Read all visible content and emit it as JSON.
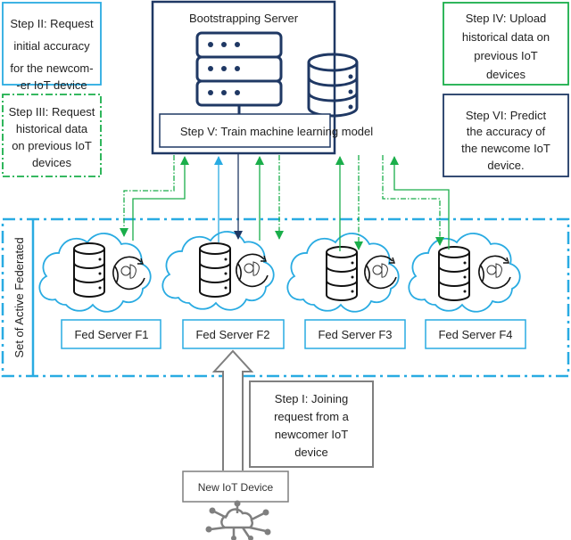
{
  "colors": {
    "blue": "#29abe2",
    "green": "#1aae4a",
    "navy": "#1f3864",
    "gray": "#7f7f7f"
  },
  "bootstrap": {
    "title": "Bootstrapping Server",
    "step5": "Step V: Train machine learning model"
  },
  "steps": {
    "step1": [
      "Step I: Joining",
      "request from a",
      "newcomer IoT",
      "device"
    ],
    "step2": [
      "Step II: Request",
      "initial accuracy",
      "for the newcom-",
      "-er IoT device"
    ],
    "step3": [
      "Step III: Request",
      "historical data",
      "on previous IoT",
      "devices"
    ],
    "step4": [
      "Step IV: Upload",
      "historical data on",
      "previous IoT",
      "devices"
    ],
    "step6": [
      "Step VI: Predict",
      "the accuracy of",
      "the newcome IoT",
      "device."
    ]
  },
  "federated": {
    "label": "Set of Active Federated",
    "servers": [
      "Fed Server F1",
      "Fed Server F2",
      "Fed Server F3",
      "Fed Server F4"
    ]
  },
  "device": {
    "label": "New IoT Device"
  },
  "icons": [
    "server-rack-icon",
    "database-icon",
    "cloud-icon",
    "brain-cycle-icon",
    "iot-cloud-network-icon"
  ]
}
